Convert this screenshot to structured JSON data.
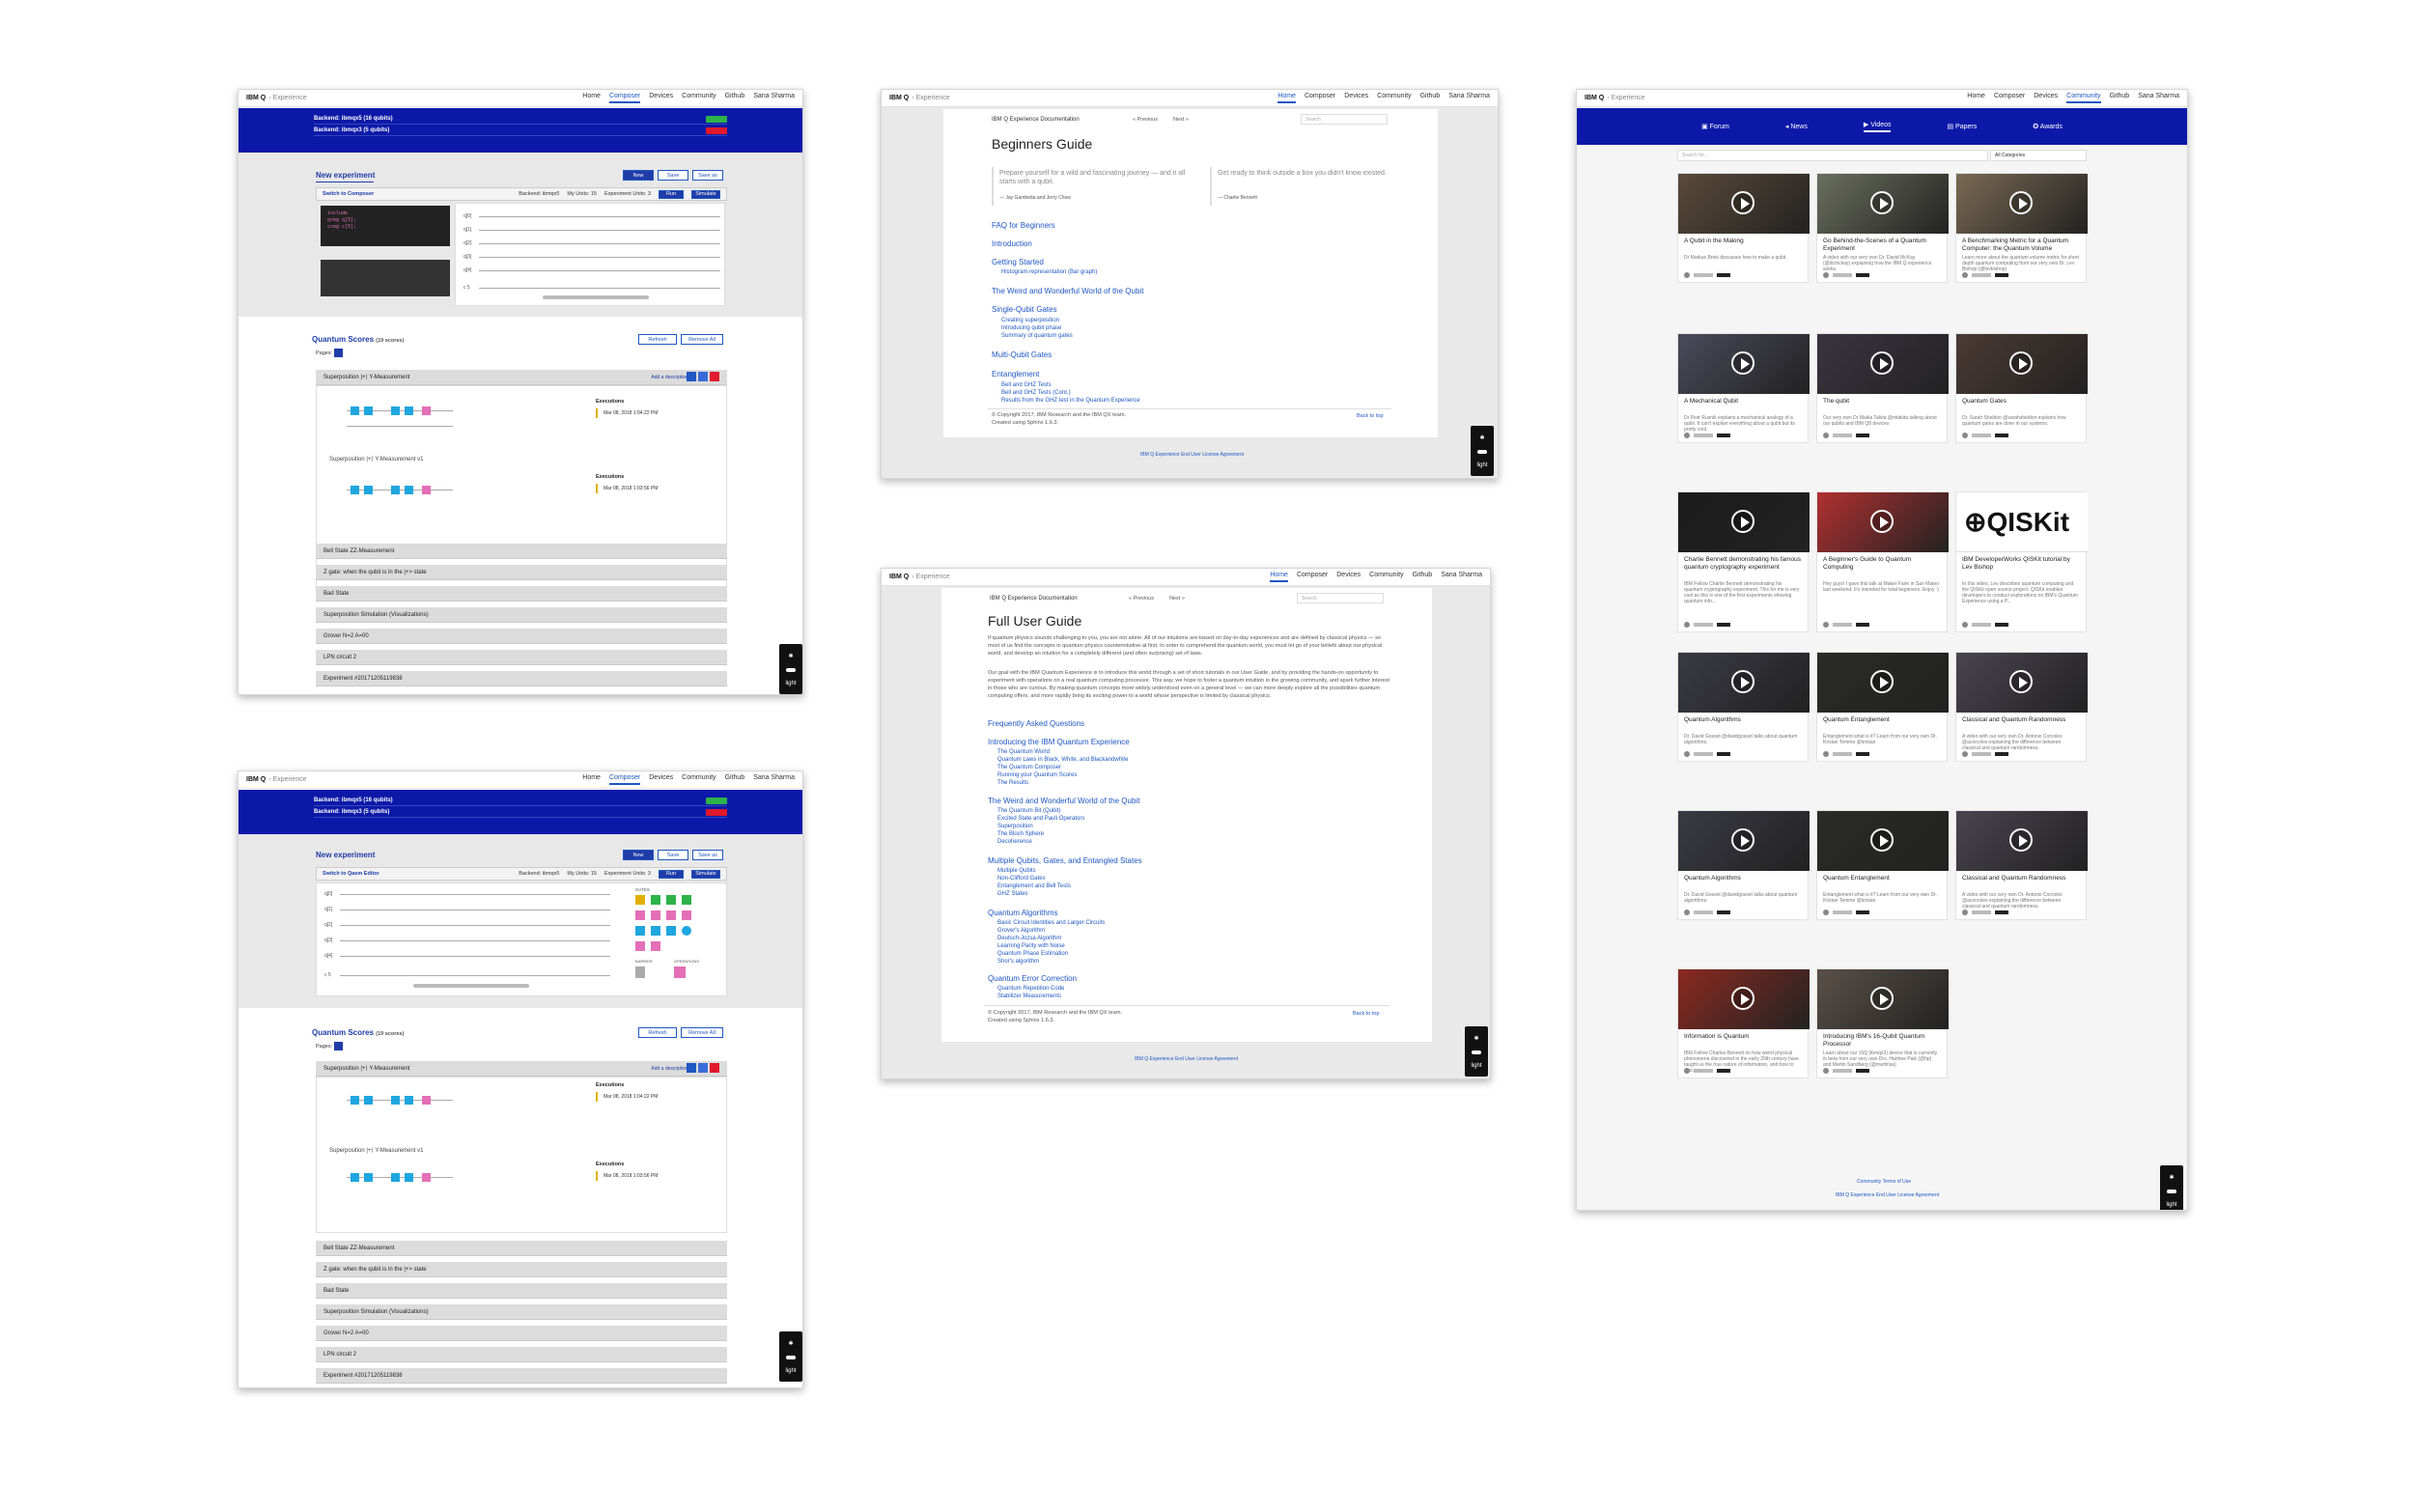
{
  "brand": "IBM Q",
  "brand_sub": "Experience",
  "nav_links": [
    "Home",
    "Composer",
    "Devices",
    "Community",
    "Github",
    "Sana Sharma"
  ],
  "composer": {
    "backends": [
      {
        "label": "Backend: ibmqx5 (16 qubits)",
        "color": "#2db34a"
      },
      {
        "label": "Backend: ibmqx3 (5 qubits)",
        "color": "#e0192d"
      }
    ],
    "new_experiment": "New experiment",
    "buttons": [
      "New",
      "Save",
      "Save as"
    ],
    "switch_qasm": "Switch to Composer",
    "switch_editor": "Switch to Qasm Editor",
    "backend_label": "Backend: ibmqx5",
    "my_units": "My Units: 15",
    "exp_units": "Experiment Units: 3",
    "run": "Run",
    "simulate": "Simulate",
    "qubits": [
      "q[0]",
      "q[1]",
      "q[2]",
      "q[3]",
      "q[4]"
    ],
    "creg": "c 5",
    "scores_title": "Quantum Scores",
    "scores_count": "(19 scores)",
    "refresh": "Refresh",
    "remove_all": "Remove All",
    "pages": "Pages:",
    "score1": "Superposition |+⟩ Y-Measurement",
    "score2": "Superposition |+⟩ Y-Measurement v1",
    "add_desc": "Add a description",
    "executions": "Executions",
    "exec_date1": "Mar 08, 2018 1:04:22 PM",
    "exec_date2": "Mar 08, 2018 1:03:56 PM",
    "accordion": [
      "Bell State ZZ-Measurement",
      "Z gate: when the qubit is in the |+> state",
      "Bad State",
      "Superposition Simulation (Visualizations)",
      "Grover N=2 A=00",
      "LPN circuit 2",
      "Experiment #20171205119838"
    ],
    "gates_label": "GATES",
    "barrier": "BARRIER",
    "operations": "OPERATIONS",
    "light": "light"
  },
  "beginners": {
    "doc_brand": "IBM Q Experience Documentation",
    "prev": "« Previous",
    "next": "Next »",
    "search": "Search",
    "title": "Beginners Guide",
    "quote1": "Prepare yourself for a wild and fascinating journey — and it all starts with a qubit.",
    "quote1_by": "— Jay Gambetta and Jerry Chow",
    "quote2": "Get ready to think outside a box you didn't know existed.",
    "quote2_by": "— Charlie Bennett",
    "sections": [
      {
        "h": "FAQ for Beginners",
        "items": []
      },
      {
        "h": "Introduction",
        "items": []
      },
      {
        "h": "Getting Started",
        "items": [
          "Histogram representation (Bar graph)"
        ]
      },
      {
        "h": "The Weird and Wonderful World of the Qubit",
        "items": []
      },
      {
        "h": "Single-Qubit Gates",
        "items": [
          "Creating superposition",
          "Introducing qubit phase",
          "Summary of quantum gates"
        ]
      },
      {
        "h": "Multi-Qubit Gates",
        "items": []
      },
      {
        "h": "Entanglement",
        "items": [
          "Bell and GHZ Tests",
          "Bell and GHZ Tests (Cont.)",
          "Results from the GHZ test in the Quantum Experience"
        ]
      }
    ],
    "copyright": "© Copyright 2017, IBM Research and the IBM QX team.",
    "created": "Created using Sphinx 1.6.3.",
    "back_top": "Back to top",
    "eula": "IBM Q Experience End User License Agreement"
  },
  "fullguide": {
    "title": "Full User Guide",
    "para1": "If quantum physics sounds challenging to you, you are not alone. All of our intuitions are based on day-to-day experiences and are defined by classical physics — so most of us find the concepts in quantum physics counterintuitive at first. In order to comprehend the quantum world, you must let go of your beliefs about our physical world, and develop an intuition for a completely different (and often surprising) set of laws.",
    "para2": "Our goal with the IBM Quantum Experience is to introduce this world through a set of short tutorials in our User Guide, and by providing the hands-on opportunity to experiment with operations on a real quantum computing processor. This way, we hope to foster a quantum intuition in the growing community, and spark further interest in those who are curious. By making quantum concepts more widely understood even on a general level — we can more deeply explore all the possibilities quantum computing offers, and more rapidly bring its exciting power to a world whose perspective is limited by classical physics.",
    "sections": [
      {
        "h": "Frequently Asked Questions",
        "items": []
      },
      {
        "h": "Introducing the IBM Quantum Experience",
        "items": [
          "The Quantum World",
          "Quantum Laws in Black, White, and Blackandwhite",
          "The Quantum Composer",
          "Running your Quantum Scores",
          "The Results"
        ]
      },
      {
        "h": "The Weird and Wonderful World of the Qubit",
        "items": [
          "The Quantum Bit (Qubit)",
          "Excited State and Pauli Operators",
          "Superposition",
          "The Bloch Sphere",
          "Decoherence"
        ]
      },
      {
        "h": "Multiple Qubits, Gates, and Entangled States",
        "items": [
          "Multiple Qubits",
          "Non-Clifford Gates",
          "Entanglement and Bell Tests",
          "GHZ States"
        ]
      },
      {
        "h": "Quantum Algorithms",
        "items": [
          "Basic Circuit Identities and Larger Circuits",
          "Grover's Algorithm",
          "Deutsch-Jozsa Algorithm",
          "Learning Parity with Noise",
          "Quantum Phase Estimation",
          "Shor's algorithm"
        ]
      },
      {
        "h": "Quantum Error Correction",
        "items": [
          "Quantum Repetition Code",
          "Stabilizer Measurements"
        ]
      }
    ]
  },
  "community": {
    "tabs": [
      "Forum",
      "News",
      "Videos",
      "Papers",
      "Awards"
    ],
    "search": "Search for...",
    "category": "All Categories",
    "videos": [
      {
        "t": "A Qubit in the Making",
        "d": "Dr Markus Brink discusses how to make a qubit.",
        "bg": "#5a4a3a"
      },
      {
        "t": "Go Behind-the-Scenes of a Quantum Experiment",
        "d": "A video with our very own Dr. David McKay (@dcmckay) explaining how the IBM Q experience works.",
        "bg": "#6b6f5e"
      },
      {
        "t": "A Benchmarking Metric for a Quantum Computer: the Quantum Volume",
        "d": "Learn more about the quantum volume metric for short depth quantum computing from our very own Dr. Lev Bishop (@levbishop)",
        "bg": "#7a6a52"
      },
      {
        "t": "A Mechanical Qubit",
        "d": "Dr Piotr Rusnik explains a mechanical analogy of a qubit. It can't explain everything about a qubit but its pretty cool.",
        "bg": "#4a4a5a"
      },
      {
        "t": "The qubit",
        "d": "Our very own Dr Maika Takita @mtakita talking about our qubits and IBM Q8 devices",
        "bg": "#3a3440"
      },
      {
        "t": "Quantum Gates",
        "d": "Dr. Sarah Sheldon @sarahsheldon explains how quantum gates are done in our systems.",
        "bg": "#4a3a34"
      },
      {
        "t": "Charlie Bennett demonstrating his famous quantum cryptography experiment",
        "d": "IBM Fellow Charlie Bennett demonstrating his quantum cryptography experiment. This for me is very cool as this is one of the first experiments showing quantum info...",
        "bg": "#1c1c1c"
      },
      {
        "t": "A Beginner's Guide to Quantum Computing",
        "d": "Hey guys! I gave this talk at Maker Faire in San Mateo last weekend. It's intended for total beginners. Enjoy :)",
        "bg": "#b03030"
      },
      {
        "t": "IBM DeveloperWorks QISKit tutorial by Lev Bishop",
        "d": "In this video, Lev describes quantum computing and the QISKit open source project. QISKit enables developers to conduct explorations on IBM's Quantum Experience using a P...",
        "bg": "#ffffff"
      },
      {
        "t": "Quantum Algorithms",
        "d": "Dr. David Gosset @davidgosset talks about quantum algorithms.",
        "bg": "#3a3a44"
      },
      {
        "t": "Quantum Entanglement",
        "d": "Entanglement what is it? Learn from our very own Dr. Kristan Temme @kristan",
        "bg": "#2a2a26"
      },
      {
        "t": "Classical and Quantum Randomness",
        "d": "A video with our very own Dr. Antonio Corcoles @acorcoles explaining the difference between classical and quantum randomness.",
        "bg": "#4a4450"
      },
      {
        "t": "Quantum Algorithms",
        "d": "Dr. David Gosset @davidgosset talks about quantum algorithms.",
        "bg": "#3a3a44"
      },
      {
        "t": "Quantum Entanglement",
        "d": "Entanglement what is it? Learn from our very own Dr. Kristan Temme @kristan",
        "bg": "#2a2a26"
      },
      {
        "t": "Classical and Quantum Randomness",
        "d": "A video with our very own Dr. Antonio Corcoles @acorcoles explaining the difference between classical and quantum randomness.",
        "bg": "#4a4450"
      },
      {
        "t": "Information is Quantum",
        "d": "IBM Fellow Charles Bennett on how weird physical phenomena discovered in the early 20th century have taught us the true nature of information, and how to proces...",
        "bg": "#8a2a20"
      },
      {
        "t": "Introducing IBM's 16-Qubit Quantum Processor",
        "d": "Learn about our 16Q (ibmqx3) device that is currently in beta from our very own Drs. Hanhee Paik (@hp) and Martin Sandberg (@martinsa)",
        "bg": "#5a5048"
      }
    ],
    "footer1": "Community Terms of Use",
    "footer2": "IBM Q Experience End User License Agreement"
  },
  "colors": {
    "blue": "#0c19a8",
    "link": "#1f57c3",
    "cyan": "#1fa6df",
    "pink": "#e46fb6",
    "green": "#2db34a",
    "red": "#e0192d"
  }
}
